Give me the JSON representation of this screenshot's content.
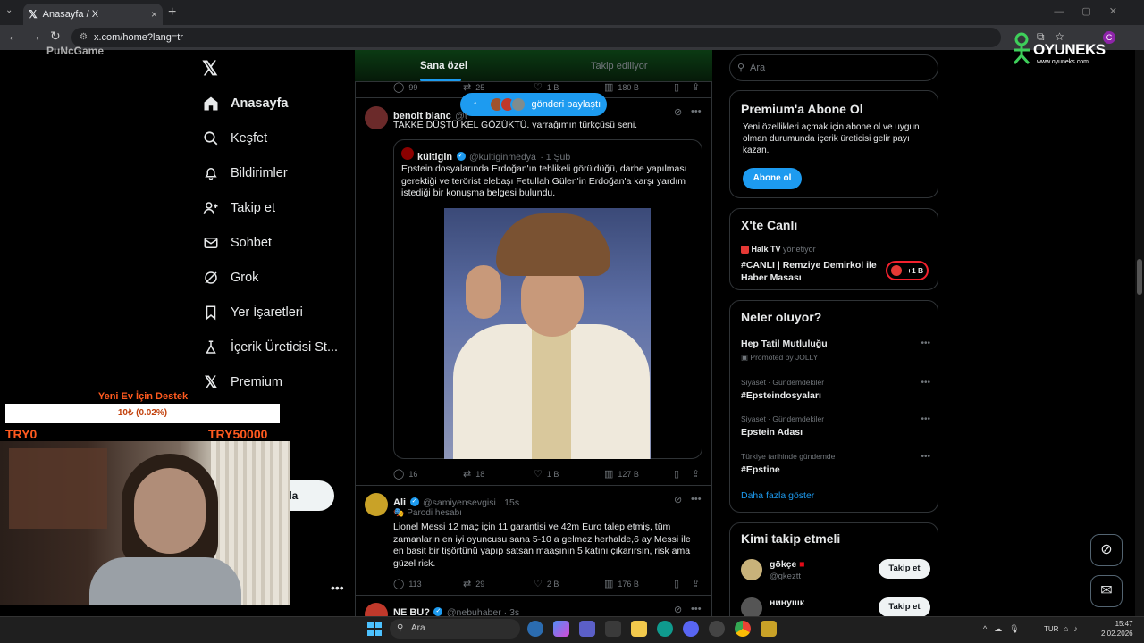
{
  "browser": {
    "tab_title": "Anasayfa / X",
    "tab_close": "×",
    "new_tab": "+",
    "url": "x.com/home?lang=tr",
    "profile_initial": "C"
  },
  "overlays": {
    "oyuneks_brand": "OYUNEKS",
    "oyuneks_site": "www.oyuneks.com",
    "punch_corner": "PuNcGame",
    "donate_title": "Yeni Ev İçin Destek",
    "donate_progress_text": "10₺ (0.02%)",
    "donate_progress_fraction": 0.0002,
    "donate_min": "TRY0",
    "donate_max": "TRY50000"
  },
  "sidebar": {
    "items": [
      {
        "label": "Anasayfa",
        "icon": "home-icon"
      },
      {
        "label": "Keşfet",
        "icon": "search-icon"
      },
      {
        "label": "Bildirimler",
        "icon": "bell-icon"
      },
      {
        "label": "Takip et",
        "icon": "person-add-icon"
      },
      {
        "label": "Sohbet",
        "icon": "mail-icon"
      },
      {
        "label": "Grok",
        "icon": "grok-icon"
      },
      {
        "label": "Yer İşaretleri",
        "icon": "bookmark-icon"
      },
      {
        "label": "İçerik Üreticisi St...",
        "icon": "creator-studio-icon"
      },
      {
        "label": "Premium",
        "icon": "x-icon"
      }
    ],
    "post_button_fragment": "nla",
    "more": "•••"
  },
  "feed": {
    "tabs": [
      "Sana özel",
      "Takip ediliyor"
    ],
    "new_posts_pill": "gönderi paylaştı",
    "prev_tweet_stats": {
      "replies": "99",
      "retweets": "25",
      "likes": "1 B",
      "views": "180 B"
    },
    "tweets": [
      {
        "name": "benoit blanc",
        "handle": "@t",
        "text": "TAKKE DÜŞTÜ KEL GÖZÜKTÜ. yarrağımın türkçüsü seni.",
        "quote": {
          "name": "kültigin",
          "handle": "@kultiginmedya",
          "time": "· 1 Şub",
          "text": "Epstein dosyalarında Erdoğan'ın tehlikeli görüldüğü, darbe yapılması gerektiği ve terörist elebaşı Fetullah Gülen'in Erdoğan'a karşı yardım istediği bir konuşma belgesi bulundu."
        },
        "stats": {
          "replies": "16",
          "retweets": "18",
          "likes": "1 B",
          "views": "127 B"
        }
      },
      {
        "name": "Ali",
        "handle": "@samiyensevgisi · 15s",
        "label": "Parodi hesabı",
        "text": "Lionel Messi 12 maç için 11 garantisi ve 42m Euro talep etmiş, tüm zamanların en iyi oyuncusu sana 5-10 a gelmez herhalde,6 ay Messi ile en basit bir tişörtünü yapıp satsan maaşının 5 katını çıkarırsın, risk ama güzel risk.",
        "stats": {
          "replies": "113",
          "retweets": "29",
          "likes": "2 B",
          "views": "176 B"
        }
      },
      {
        "name": "NE BU?",
        "handle": "@nebuhaber · 3s"
      }
    ]
  },
  "right": {
    "search_placeholder": "Ara",
    "premium": {
      "title": "Premium'a Abone Ol",
      "text": "Yeni özellikleri açmak için abone ol ve uygun olman durumunda içerik üreticisi gelir payı kazan.",
      "button": "Abone ol"
    },
    "live": {
      "title": "X'te Canlı",
      "host": "Halk TV",
      "host_role": "yönetiyor",
      "stream_title": "#CANLI | Remziye Demirkol ile Haber Masası",
      "listeners": "+1 B"
    },
    "trends": {
      "title": "Neler oluyor?",
      "items": [
        {
          "category": "",
          "title": "Hep Tatil Mutluluğu",
          "promoted": "Promoted by JOLLY"
        },
        {
          "category": "Siyaset · Gündemdekiler",
          "title": "#Epsteindosyaları"
        },
        {
          "category": "Siyaset · Gündemdekiler",
          "title": "Epstein Adası"
        },
        {
          "category": "Türkiye tarihinde gündemde",
          "title": "#Epstine"
        }
      ],
      "show_more": "Daha fazla göster"
    },
    "who_to_follow": {
      "title": "Kimi takip etmeli",
      "users": [
        {
          "name": "gökçe",
          "handle": "@gkeztt",
          "button": "Takip et"
        },
        {
          "name": "нинушк",
          "handle": "",
          "button": "Takip et"
        }
      ]
    }
  },
  "taskbar": {
    "search": "Ara",
    "lang": "TUR",
    "time": "15:47",
    "date": "2.02.2026"
  }
}
